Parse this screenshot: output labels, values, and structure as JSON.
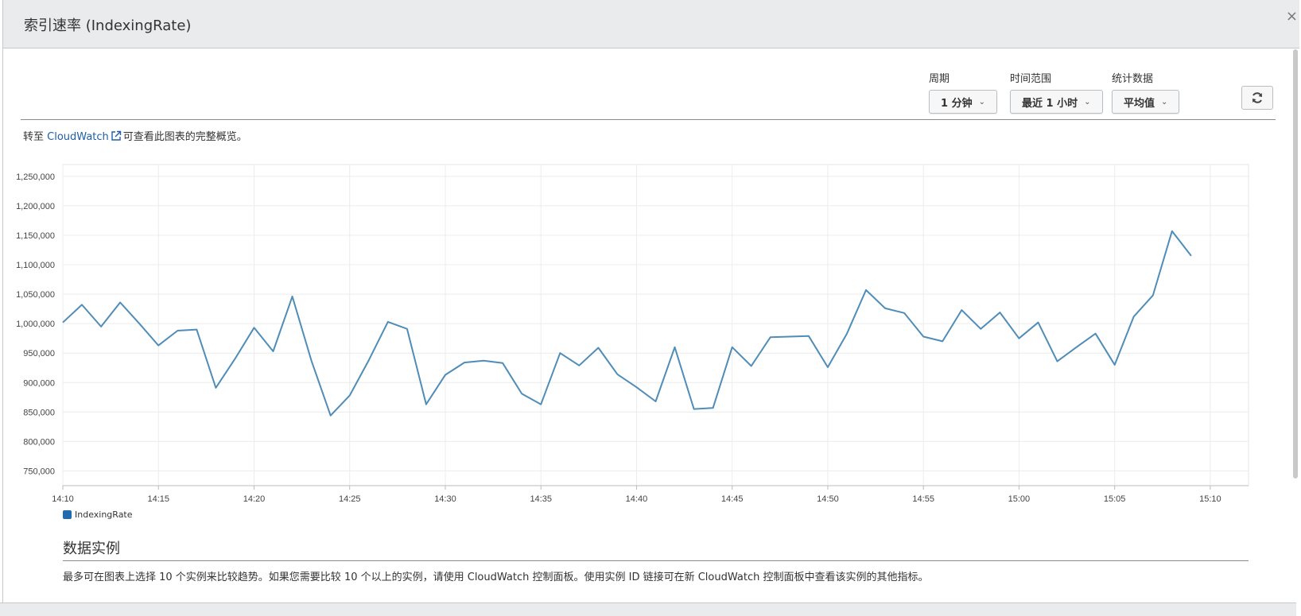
{
  "modal": {
    "title": "索引速率 (IndexingRate)",
    "close_label": "×"
  },
  "controls": {
    "period": {
      "label": "周期",
      "value": "1 分钟"
    },
    "time_range": {
      "label": "时间范围",
      "value": "最近 1 小时"
    },
    "statistic": {
      "label": "统计数据",
      "value": "平均值"
    },
    "refresh_icon": "refresh-icon"
  },
  "cloudwatch_note": {
    "prefix": "转至",
    "link": "CloudWatch",
    "suffix": "可查看此图表的完整概览。"
  },
  "chart_data": {
    "type": "line",
    "title": "",
    "xlabel": "",
    "ylabel": "",
    "x_tick_labels": [
      "14:10",
      "14:15",
      "14:20",
      "14:25",
      "14:30",
      "14:35",
      "14:40",
      "14:45",
      "14:50",
      "14:55",
      "15:00",
      "15:05",
      "15:10"
    ],
    "y_tick_labels": [
      "750,000",
      "800,000",
      "850,000",
      "900,000",
      "950,000",
      "1,000,000",
      "1,050,000",
      "1,100,000",
      "1,150,000",
      "1,200,000",
      "1,250,000"
    ],
    "ylim": [
      725000,
      1270000
    ],
    "xlim_minutes_from_1410": [
      0,
      62
    ],
    "grid": true,
    "legend_position": "bottom-left",
    "series": [
      {
        "name": "IndexingRate",
        "color": "#4f8db8",
        "x": [
          "14:10",
          "14:11",
          "14:12",
          "14:13",
          "14:14",
          "14:15",
          "14:16",
          "14:17",
          "14:18",
          "14:19",
          "14:20",
          "14:21",
          "14:22",
          "14:23",
          "14:24",
          "14:25",
          "14:26",
          "14:27",
          "14:28",
          "14:29",
          "14:30",
          "14:31",
          "14:32",
          "14:33",
          "14:34",
          "14:35",
          "14:36",
          "14:37",
          "14:38",
          "14:39",
          "14:40",
          "14:41",
          "14:42",
          "14:43",
          "14:44",
          "14:45",
          "14:46",
          "14:47",
          "14:48",
          "14:49",
          "14:50",
          "14:51",
          "14:52",
          "14:53",
          "14:54",
          "14:55",
          "14:56",
          "14:57",
          "14:58",
          "14:59",
          "15:00",
          "15:01",
          "15:02",
          "15:03",
          "15:04",
          "15:05",
          "15:06",
          "15:07",
          "15:08",
          "15:09"
        ],
        "values": [
          1002000,
          1032000,
          995000,
          1036000,
          1000000,
          963000,
          988000,
          990000,
          891000,
          940000,
          993000,
          953000,
          1046000,
          937000,
          844000,
          878000,
          938000,
          1003000,
          991000,
          863000,
          913000,
          934000,
          937000,
          933000,
          881000,
          863000,
          950000,
          929000,
          959000,
          914000,
          892000,
          868000,
          960000,
          855000,
          857000,
          960000,
          928000,
          977000,
          978000,
          979000,
          926000,
          983000,
          1057000,
          1026000,
          1018000,
          978000,
          970000,
          1023000,
          991000,
          1019000,
          975000,
          1002000,
          936000,
          960000,
          983000,
          930000,
          1012000,
          1048000,
          1157000,
          1115000
        ]
      }
    ]
  },
  "legend": {
    "label": "IndexingRate"
  },
  "section": {
    "title": "数据实例",
    "description": "最多可在图表上选择 10 个实例来比较趋势。如果您需要比较 10 个以上的实例，请使用 CloudWatch 控制面板。使用实例 ID 链接可在新 CloudWatch 控制面板中查看该实例的其他指标。"
  }
}
